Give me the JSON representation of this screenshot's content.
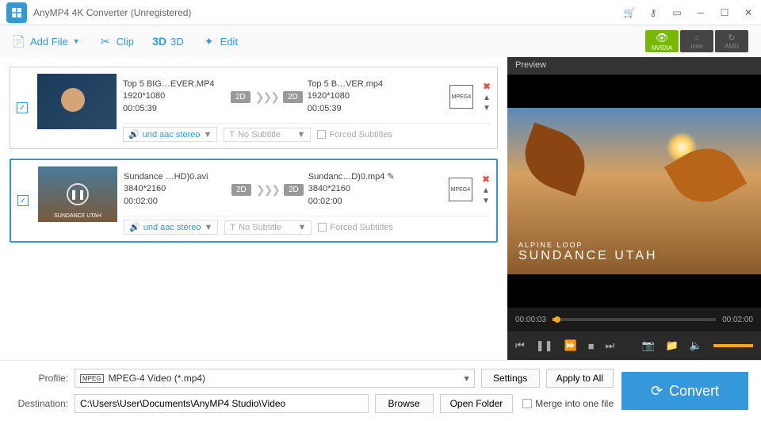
{
  "titlebar": {
    "title": "AnyMP4 4K Converter (Unregistered)"
  },
  "toolbar": {
    "addfile": "Add File",
    "clip": "Clip",
    "threed": "3D",
    "edit": "Edit",
    "gpu": {
      "nvidia": "NVIDIA",
      "intel": "intel",
      "amd": "AMD"
    }
  },
  "items": [
    {
      "src": {
        "name": "Top 5 BIG…EVER.MP4",
        "res": "1920*1080",
        "dur": "00:05:39"
      },
      "dst": {
        "name": "Top 5 B…VER.mp4",
        "res": "1920*1080",
        "dur": "00:05:39"
      },
      "badge": "2D",
      "fmt": "MPEG4",
      "audio": "und aac stereo",
      "subtitle": "No Subtitle",
      "forced": "Forced Subtitles"
    },
    {
      "src": {
        "name": "Sundance …HD)0.avi",
        "res": "3840*2160",
        "dur": "00:02:00"
      },
      "dst": {
        "name": "Sundanc…D)0.mp4",
        "res": "3840*2160",
        "dur": "00:02:00"
      },
      "badge": "2D",
      "fmt": "MPEG4",
      "audio": "und aac stereo",
      "subtitle": "No Subtitle",
      "forced": "Forced Subtitles",
      "thumbLabel": "SUNDANCE UTAH"
    }
  ],
  "preview": {
    "title": "Preview",
    "overlaySmall": "ALPINE LOOP",
    "overlayBig": "SUNDANCE UTAH",
    "current": "00:00:03",
    "total": "00:02:00"
  },
  "bottom": {
    "profileLabel": "Profile:",
    "profileValue": "MPEG-4 Video (*.mp4)",
    "settings": "Settings",
    "applyAll": "Apply to All",
    "destLabel": "Destination:",
    "destValue": "C:\\Users\\User\\Documents\\AnyMP4 Studio\\Video",
    "browse": "Browse",
    "openFolder": "Open Folder",
    "merge": "Merge into one file",
    "convert": "Convert"
  }
}
